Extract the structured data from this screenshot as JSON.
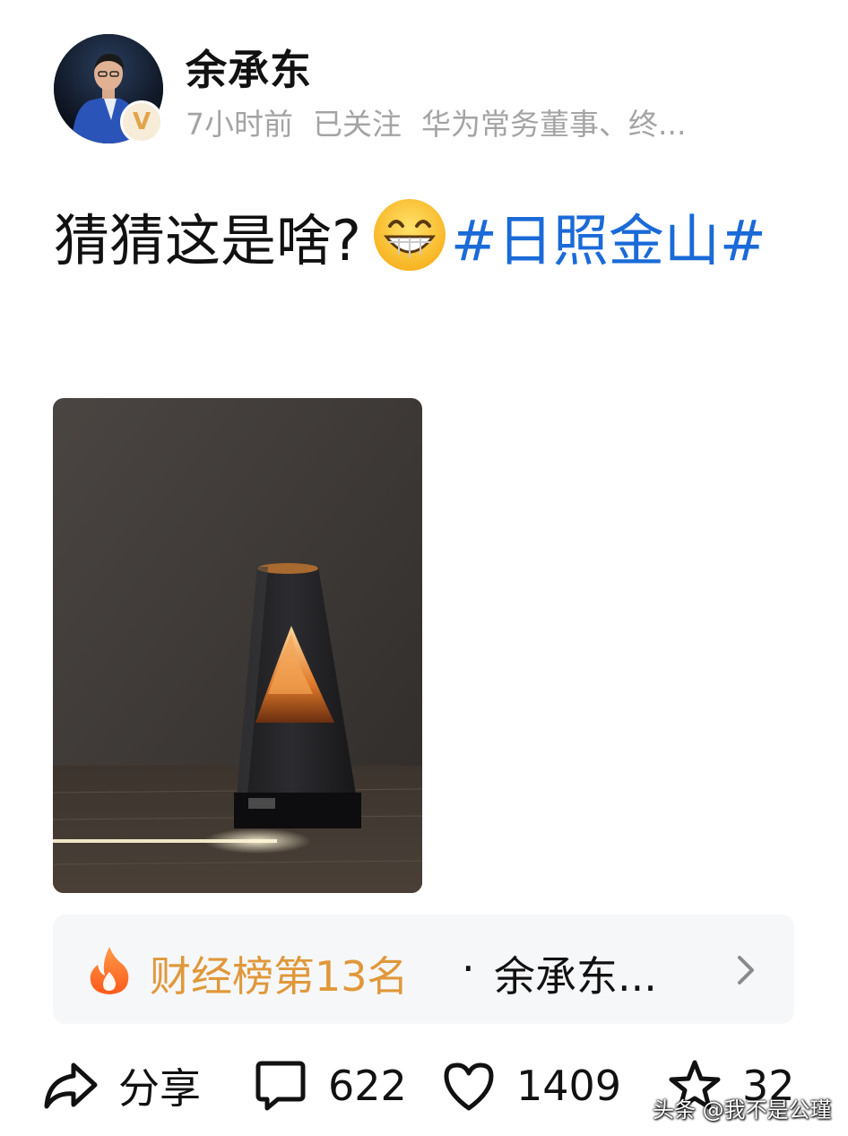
{
  "post": {
    "author": "余承东",
    "time": "7小时前",
    "follow_status": "已关注",
    "author_bio": "华为常务董事、终...",
    "text": "猜猜这是啥?",
    "emoji_icon": "grinning-face-icon",
    "hashtag": "#日照金山#"
  },
  "hot_list": {
    "rank_text": "财经榜第13名",
    "separator": "·",
    "topic": "余承东...",
    "rank_color": "#e0983a"
  },
  "actions": {
    "share_label": "分享",
    "comment_count": "622",
    "like_count": "1409",
    "favorite_count": "32"
  },
  "watermark": "头条 @我不是公瑾",
  "colors": {
    "hashtag": "#1a6ad8",
    "meta_gray": "#a4a4a4",
    "verified_gold": "#e2a44a"
  }
}
